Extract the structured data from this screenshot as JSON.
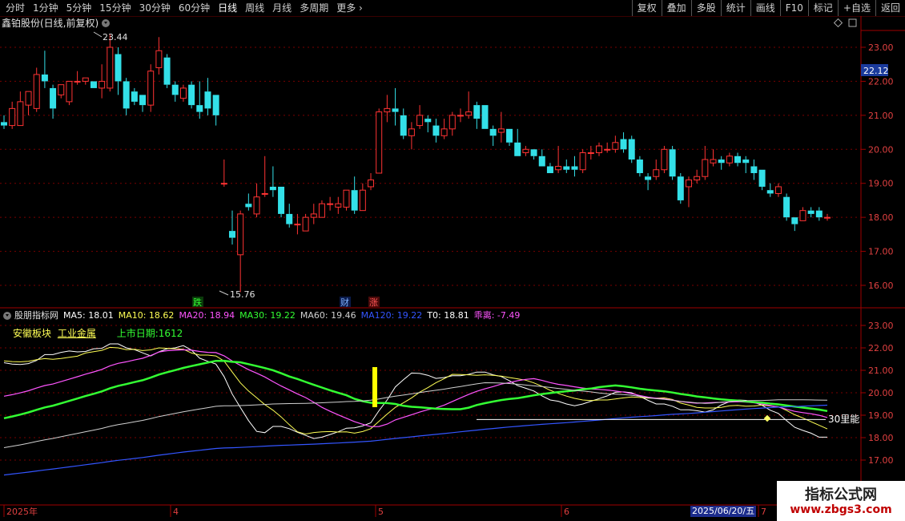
{
  "toolbar": {
    "periods": [
      "分时",
      "1分钟",
      "5分钟",
      "15分钟",
      "30分钟",
      "60分钟",
      "日线",
      "周线",
      "月线",
      "多周期",
      "更多"
    ],
    "active_period": "日线",
    "right_buttons": [
      "复权",
      "叠加",
      "多股",
      "统计",
      "画线",
      "F10",
      "标记",
      "+自选",
      "返回"
    ]
  },
  "main_chart": {
    "title": "鑫铂股份(日线,前复权)",
    "y_ticks": [
      "23.00",
      "22.00",
      "21.00",
      "20.00",
      "19.00",
      "18.00",
      "17.00",
      "16.00"
    ],
    "current_price": "22.12",
    "high_label": "23.44",
    "low_label": "15.76",
    "markers": [
      "跌",
      "财",
      "涨"
    ]
  },
  "indicator": {
    "name": "股朋指标网",
    "legend": [
      {
        "label": "MA5: 18.01",
        "color": "#ffffff"
      },
      {
        "label": "MA10: 18.62",
        "color": "#ffff55"
      },
      {
        "label": "MA20: 18.94",
        "color": "#ff55ff"
      },
      {
        "label": "MA30: 19.22",
        "color": "#33ff33"
      },
      {
        "label": "MA60: 19.46",
        "color": "#d0d0d0"
      },
      {
        "label": "MA120: 19.22",
        "color": "#3355ff"
      },
      {
        "label": "T0: 18.81",
        "color": "#ffffff"
      },
      {
        "label": "乖离: -7.49",
        "color": "#ff55ff"
      }
    ],
    "sector_1": "安徽板块",
    "sector_2": "工业金属",
    "listing_days": "上市日期:1612",
    "y_ticks": [
      "23.00",
      "22.00",
      "21.00",
      "20.00",
      "19.00",
      "18.00",
      "17.00"
    ],
    "line_label": "30里能"
  },
  "time_axis": {
    "labels": [
      "2025年",
      "4",
      "5",
      "6",
      "7"
    ],
    "current_date": "2025/06/20/五"
  },
  "watermark": {
    "line1": "指标公式网",
    "line2": "www.zbgs3.com"
  },
  "candles": [
    [
      20.8,
      20.7,
      20.6,
      21.0
    ],
    [
      20.7,
      21.2,
      20.6,
      21.4
    ],
    [
      20.7,
      21.4,
      20.8,
      21.7
    ],
    [
      21.3,
      21.7,
      21.0,
      21.7
    ],
    [
      21.2,
      22.2,
      21.1,
      22.4
    ],
    [
      22.2,
      22.0,
      21.8,
      22.9
    ],
    [
      21.8,
      21.2,
      20.9,
      21.9
    ],
    [
      21.6,
      21.9,
      21.5,
      21.9
    ],
    [
      21.4,
      22.0,
      21.3,
      22.0
    ],
    [
      22.0,
      22.0,
      21.9,
      22.3
    ],
    [
      22.0,
      22.1,
      21.9,
      22.1
    ],
    [
      22.0,
      21.8,
      21.8,
      22.0
    ],
    [
      21.8,
      22.0,
      21.5,
      22.5
    ],
    [
      21.8,
      23.0,
      21.7,
      23.4
    ],
    [
      22.8,
      22.0,
      21.6,
      23.0
    ],
    [
      22.0,
      21.2,
      21.0,
      22.1
    ],
    [
      21.7,
      21.4,
      21.3,
      21.8
    ],
    [
      21.6,
      21.3,
      21.1,
      21.6
    ],
    [
      21.3,
      22.3,
      21.1,
      22.5
    ],
    [
      22.4,
      22.9,
      22.2,
      23.3
    ],
    [
      22.7,
      21.9,
      21.8,
      22.8
    ],
    [
      21.9,
      21.6,
      21.4,
      22.0
    ],
    [
      21.5,
      21.8,
      21.4,
      21.9
    ],
    [
      21.9,
      21.3,
      21.2,
      22.0
    ],
    [
      21.3,
      21.1,
      20.9,
      22.0
    ],
    [
      21.7,
      21.2,
      21.0,
      22.1
    ],
    [
      21.6,
      21.0,
      20.7,
      21.6
    ],
    [
      19.0,
      19.0,
      18.9,
      19.7
    ],
    [
      17.6,
      17.4,
      17.2,
      18.2
    ],
    [
      16.9,
      18.1,
      15.8,
      18.2
    ],
    [
      18.4,
      18.3,
      18.2,
      18.7
    ],
    [
      18.1,
      18.6,
      18.0,
      19.0
    ],
    [
      18.7,
      18.7,
      18.6,
      19.8
    ],
    [
      18.9,
      18.8,
      18.6,
      19.5
    ],
    [
      18.9,
      18.1,
      18.0,
      18.9
    ],
    [
      18.1,
      17.8,
      17.7,
      18.4
    ],
    [
      17.8,
      17.8,
      17.5,
      18.1
    ],
    [
      17.6,
      18.0,
      17.6,
      18.1
    ],
    [
      18.0,
      18.1,
      17.8,
      18.4
    ],
    [
      18.0,
      18.4,
      18.0,
      18.5
    ],
    [
      18.4,
      18.4,
      18.2,
      18.6
    ],
    [
      18.3,
      18.4,
      18.1,
      18.6
    ],
    [
      18.3,
      18.8,
      18.2,
      18.8
    ],
    [
      18.8,
      18.2,
      18.1,
      19.2
    ],
    [
      18.2,
      18.8,
      18.2,
      19.0
    ],
    [
      18.9,
      19.1,
      18.8,
      19.3
    ],
    [
      19.3,
      21.1,
      19.3,
      21.2
    ],
    [
      21.1,
      21.2,
      20.8,
      21.6
    ],
    [
      21.2,
      21.1,
      20.7,
      21.8
    ],
    [
      21.0,
      20.4,
      20.3,
      21.2
    ],
    [
      20.4,
      20.6,
      20.0,
      20.8
    ],
    [
      20.7,
      21.0,
      20.6,
      21.3
    ],
    [
      20.9,
      20.8,
      20.5,
      21.0
    ],
    [
      20.7,
      20.4,
      20.2,
      20.9
    ],
    [
      20.4,
      20.6,
      20.3,
      20.9
    ],
    [
      20.6,
      21.0,
      20.4,
      21.1
    ],
    [
      21.0,
      21.0,
      20.8,
      21.2
    ],
    [
      21.0,
      21.1,
      20.9,
      21.7
    ],
    [
      21.3,
      20.9,
      20.6,
      21.4
    ],
    [
      21.3,
      20.6,
      20.6,
      21.3
    ],
    [
      20.6,
      20.4,
      20.1,
      20.7
    ],
    [
      20.5,
      20.6,
      20.2,
      21.1
    ],
    [
      20.6,
      20.2,
      20.1,
      20.6
    ],
    [
      20.2,
      19.8,
      19.8,
      20.6
    ],
    [
      19.9,
      20.0,
      19.8,
      20.1
    ],
    [
      20.0,
      19.8,
      19.7,
      20.0
    ],
    [
      19.8,
      19.5,
      19.5,
      20.0
    ],
    [
      19.5,
      19.3,
      19.3,
      19.6
    ],
    [
      19.4,
      19.5,
      19.3,
      20.1
    ],
    [
      19.5,
      19.4,
      19.3,
      19.7
    ],
    [
      19.5,
      19.4,
      19.2,
      19.8
    ],
    [
      19.4,
      19.9,
      19.3,
      20.0
    ],
    [
      19.9,
      19.9,
      19.7,
      20.1
    ],
    [
      19.9,
      20.1,
      19.8,
      20.2
    ],
    [
      20.0,
      20.0,
      19.9,
      20.2
    ],
    [
      20.0,
      20.2,
      19.9,
      20.4
    ],
    [
      20.3,
      20.0,
      19.9,
      20.5
    ],
    [
      20.3,
      19.7,
      19.6,
      20.4
    ],
    [
      19.7,
      19.3,
      19.2,
      19.8
    ],
    [
      19.2,
      19.1,
      18.8,
      19.3
    ],
    [
      19.2,
      19.4,
      19.1,
      19.7
    ],
    [
      19.4,
      20.0,
      19.3,
      20.1
    ],
    [
      20.0,
      19.2,
      19.1,
      20.1
    ],
    [
      19.2,
      18.5,
      18.4,
      19.3
    ],
    [
      18.9,
      19.1,
      18.3,
      19.2
    ],
    [
      19.1,
      19.2,
      19.0,
      19.4
    ],
    [
      19.2,
      19.7,
      19.1,
      20.1
    ],
    [
      19.6,
      19.7,
      19.5,
      20.0
    ],
    [
      19.7,
      19.6,
      19.4,
      19.8
    ],
    [
      19.6,
      19.8,
      19.5,
      19.9
    ],
    [
      19.8,
      19.6,
      19.5,
      19.9
    ],
    [
      19.7,
      19.6,
      19.3,
      19.8
    ],
    [
      19.5,
      19.3,
      19.1,
      19.7
    ],
    [
      19.4,
      18.9,
      18.8,
      19.4
    ],
    [
      18.8,
      18.7,
      18.6,
      19.0
    ],
    [
      18.7,
      18.9,
      18.6,
      19.0
    ],
    [
      18.6,
      18.0,
      17.9,
      18.7
    ],
    [
      18.0,
      17.8,
      17.6,
      18.0
    ],
    [
      17.9,
      18.2,
      17.9,
      18.3
    ],
    [
      18.2,
      18.1,
      18.0,
      18.3
    ],
    [
      18.2,
      18.0,
      17.9,
      18.3
    ],
    [
      18.0,
      18.0,
      17.9,
      18.1
    ]
  ]
}
